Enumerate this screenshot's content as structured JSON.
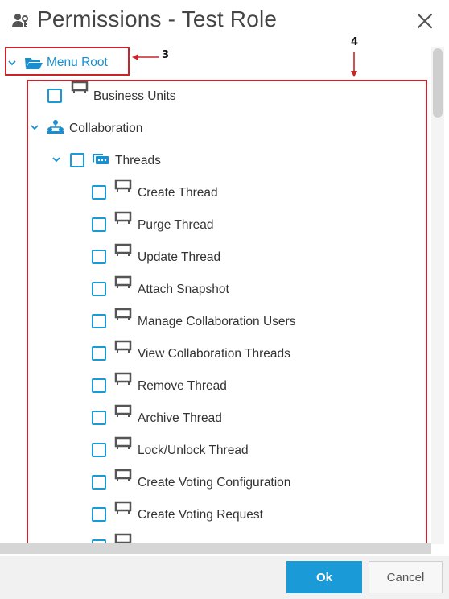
{
  "dialog": {
    "title": "Permissions - Test Role",
    "icons": {
      "title": "role-key-icon",
      "close": "close-icon"
    }
  },
  "tree": {
    "root": {
      "label": "Menu Root",
      "icon": "folder-open-icon",
      "expanded": true
    },
    "business_units": {
      "label": "Business Units",
      "icon": "feature-icon",
      "checked": false
    },
    "collaboration": {
      "label": "Collaboration",
      "icon": "org-chart-icon",
      "expanded": true
    },
    "threads": {
      "label": "Threads",
      "icon": "chat-icon",
      "expanded": true,
      "checked": false
    },
    "thread_items": [
      {
        "label": "Create Thread",
        "checked": false
      },
      {
        "label": "Purge Thread",
        "checked": false
      },
      {
        "label": "Update Thread",
        "checked": false
      },
      {
        "label": "Attach Snapshot",
        "checked": false
      },
      {
        "label": "Manage Collaboration Users",
        "checked": false
      },
      {
        "label": "View Collaboration Threads",
        "checked": false
      },
      {
        "label": "Remove Thread",
        "checked": false
      },
      {
        "label": "Archive Thread",
        "checked": false
      },
      {
        "label": "Lock/Unlock Thread",
        "checked": false
      },
      {
        "label": "Create Voting Configuration",
        "checked": false
      },
      {
        "label": "Create Voting Request",
        "checked": false
      },
      {
        "label": "",
        "checked": false
      }
    ]
  },
  "annotations": [
    {
      "number": "3"
    },
    {
      "number": "4"
    }
  ],
  "footer": {
    "ok_label": "Ok",
    "cancel_label": "Cancel"
  },
  "colors": {
    "accent": "#1a9ad6",
    "annotation": "#c8242a",
    "footer_bg": "#f1f1f1"
  }
}
